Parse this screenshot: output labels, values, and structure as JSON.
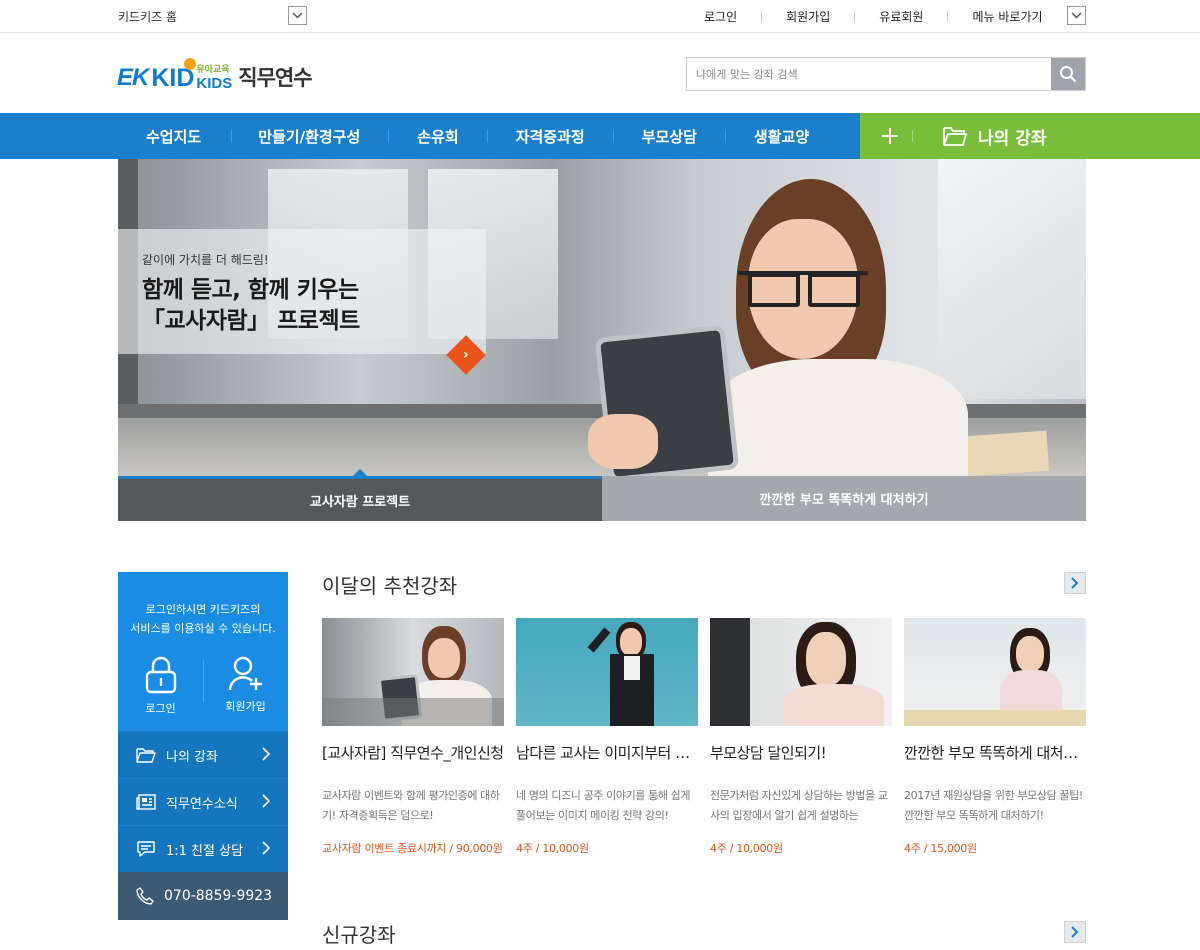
{
  "util": {
    "home_label": "키드키즈 홈",
    "links": [
      "로그인",
      "회원가입",
      "유료회원",
      "메뉴 바로가기"
    ]
  },
  "logo": {
    "ek": "EK",
    "kid": "KID",
    "small": "유아교육",
    "kids": "KIDS",
    "title": "직무연수"
  },
  "search": {
    "placeholder": "나에게 맞는 강좌 검색"
  },
  "nav": {
    "items": [
      "수업지도",
      "만들기/환경구성",
      "손유희",
      "자격증과정",
      "부모상담",
      "생활교양"
    ],
    "my_course": "나의 강좌"
  },
  "hero": {
    "small": "같이에 가치를 더 해드림!",
    "line1": "함께 듣고, 함께 키우는",
    "line2": "「교사자람」 프로젝트",
    "tabs": [
      "교사자람 프로젝트",
      "깐깐한 부모 똑똑하게 대처하기"
    ]
  },
  "sidebar": {
    "msg_line1": "로그인하시면 키드키즈의",
    "msg_line2": "서비스를 이용하실 수 있습니다.",
    "login": "로그인",
    "join": "회원가입",
    "menu": [
      "나의 강좌",
      "직무연수소식",
      "1:1 친절 상담"
    ],
    "phone": "070-8859-9923"
  },
  "recommended": {
    "title": "이달의 추천강좌",
    "cards": [
      {
        "title": "[교사자람] 직무연수_개인신청",
        "desc": "교사자람 이벤트와 함께 평가인증에 대하기! 자격증획득은 덤으로!",
        "price": "교사자람 이벤트 종료시까지 / 90,000원"
      },
      {
        "title": "남다른 교사는 이미지부터 다르다",
        "desc": "네 명의 디즈니 공주 이야기를 통해 쉽게 풀어보는 이미지 메이킹 전략 강의!",
        "price": "4주 / 10,000원"
      },
      {
        "title": "부모상담 달인되기!",
        "desc": "전문가처럼 자신있게 상담하는 방법을 교사의 입장에서 알기 쉽게 설명하는",
        "price": "4주 / 10,000원"
      },
      {
        "title": "깐깐한 부모 똑똑하게 대처하기",
        "desc": "2017년 재원상담을 위한 부모상담 꿀팁! 깐깐한 부모 똑똑하게 대처하기!",
        "price": "4주 / 15,000원"
      }
    ]
  },
  "new_courses": {
    "title": "신규강좌"
  },
  "colors": {
    "primary": "#1b7fcb",
    "accent_green": "#79bd3a",
    "price_orange": "#e0561c",
    "sidebar_blue": "#1b8ce3"
  }
}
